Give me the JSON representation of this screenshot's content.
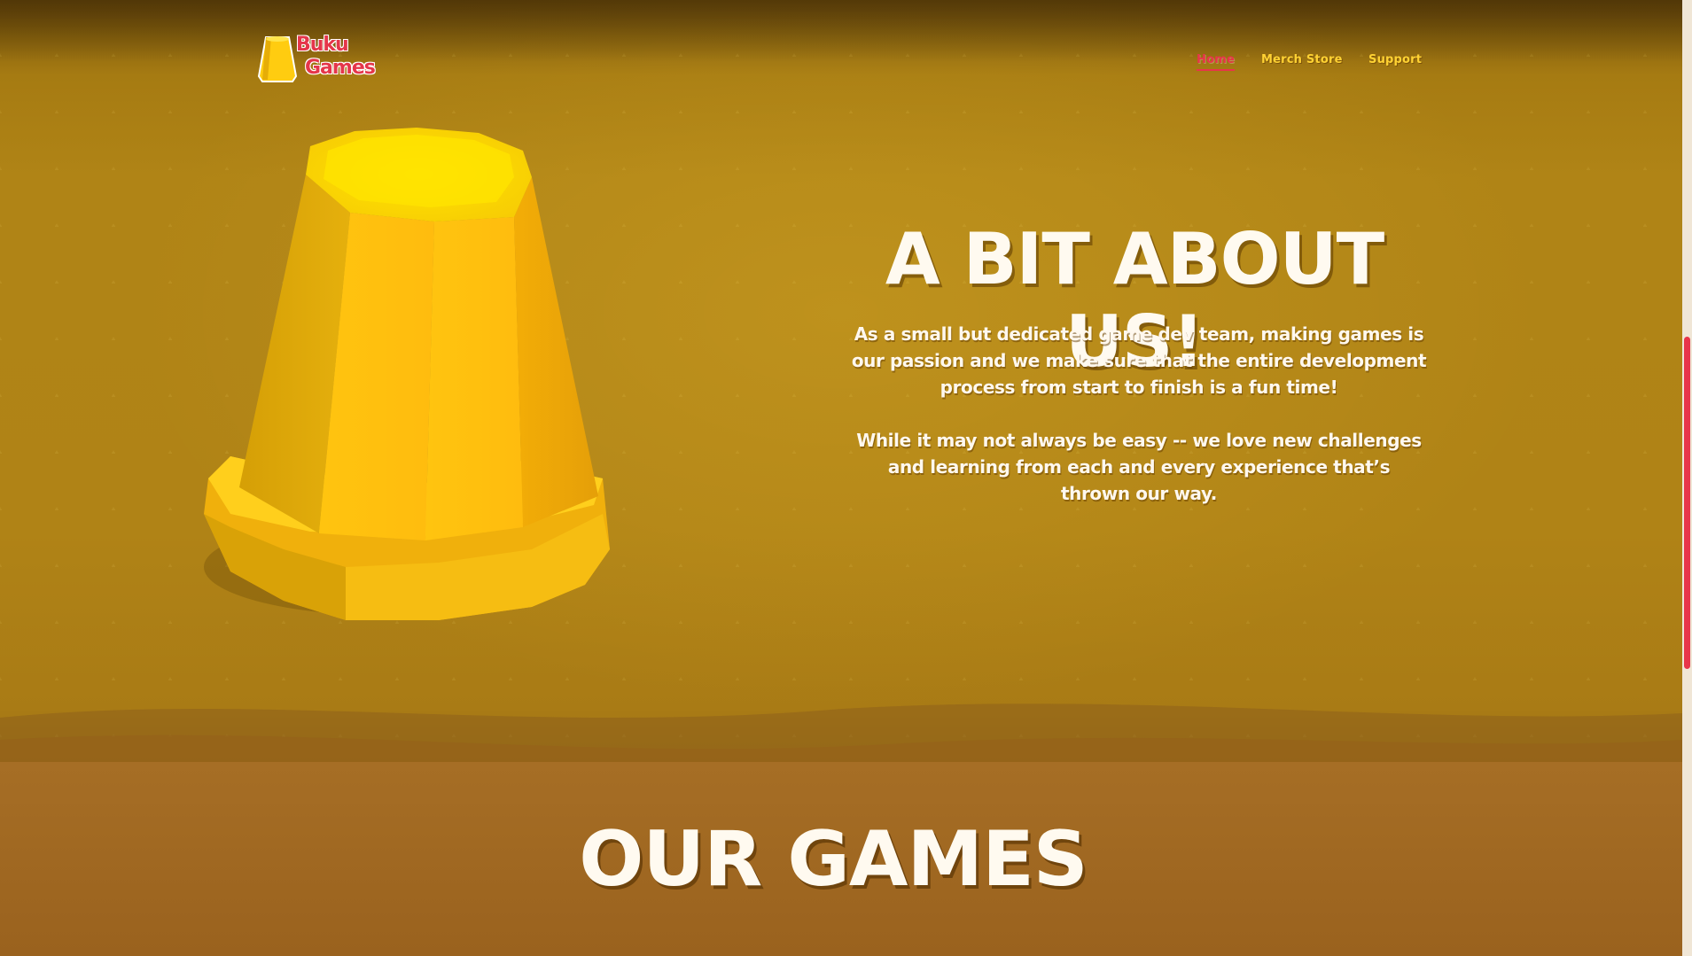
{
  "brand": {
    "logo_line1": "Buku",
    "logo_line2": "Games",
    "accent_color": "#e8354a",
    "primary_color": "#ffd233"
  },
  "nav": {
    "home": "Home",
    "merch": "Merch Store",
    "support": "Support",
    "active": "Home"
  },
  "about": {
    "title": "A BIT ABOUT US!",
    "paragraph1": "As a small but dedicated game dev team, making games is our passion and we make sure that the entire development process from start to finish is a fun time!",
    "paragraph2": "While it may not always be easy -- we love new challenges and learning from each and every experience that’s thrown our way."
  },
  "games": {
    "title": "OUR GAMES"
  },
  "icons": {
    "logo": "yellow-cup-icon",
    "hero_image": "yellow-cup-icon"
  }
}
